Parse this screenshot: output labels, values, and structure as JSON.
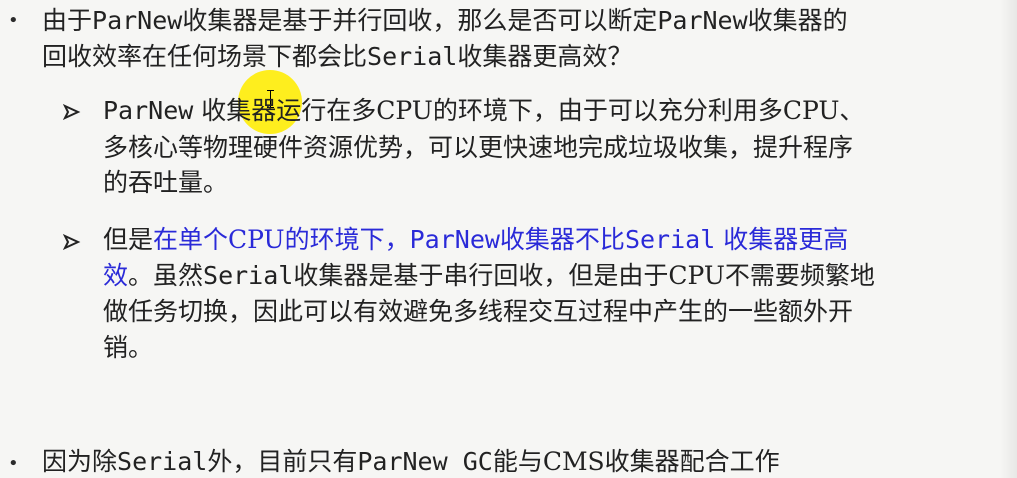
{
  "slide": {
    "questions": [
      {
        "bullet": "•",
        "line1": {
          "part1": "由于",
          "part2": "ParNew",
          "part3": "收集器是基于并行回收，那么是否可以断定",
          "part4": "ParNew",
          "part5": "收集器的"
        },
        "line2": {
          "part1": "回收效率在任何场景下都会比",
          "part2": "Serial",
          "part3": "收集器更高效？"
        }
      }
    ],
    "subpoints": [
      {
        "arrow_icon": "right-arrow-icon",
        "line1": {
          "part1": "ParNew",
          "part2": " 收集器运行在多CPU的环境下，由于可以充分利用多CPU、"
        },
        "line2": "多核心等物理硬件资源优势，可以更快速地完成垃圾收集，提升程序",
        "line3": "的吞吐量。"
      },
      {
        "arrow_icon": "right-arrow-icon",
        "line1": {
          "part1": "但是",
          "part2": "在单个CPU的环境下，",
          "part3": "ParNew",
          "part4": "收集器不比",
          "part5": "Serial",
          "part6": " 收集器更高"
        },
        "line2": {
          "part1": "效",
          "part2": "。虽然",
          "part3": "Serial",
          "part4": "收集器是基于串行回收，但是由于CPU不需要频繁地"
        },
        "line3": "做任务切换，因此可以有效避免多线程交互过程中产生的一些额外开",
        "line4": "销。"
      }
    ],
    "final_bullet": {
      "bullet": "•",
      "part1": "因为除",
      "part2": "Serial",
      "part3": "外，目前只有",
      "part4": "ParNew GC",
      "part5": "能与CMS收集器配合工作"
    },
    "colors": {
      "text": "#222222",
      "accent_blue": "#2a2ad8",
      "highlight_yellow": "#ffed00"
    }
  }
}
